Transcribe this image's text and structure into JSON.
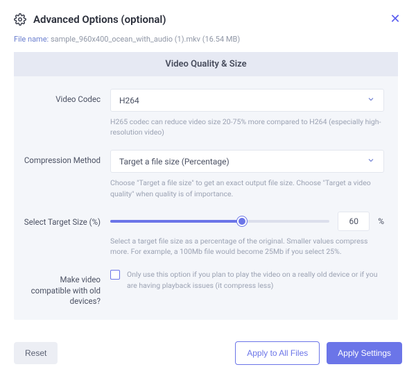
{
  "header": {
    "title": "Advanced Options (optional)"
  },
  "file": {
    "label": "File name:",
    "value": "sample_960x400_ocean_with_audio (1).mkv (16.54 MB)"
  },
  "panel": {
    "title": "Video Quality & Size",
    "codec": {
      "label": "Video Codec",
      "value": "H264",
      "help": "H265 codec can reduce video size 20-75% more compared to H264 (especially high-resolution video)"
    },
    "method": {
      "label": "Compression Method",
      "value": "Target a file size (Percentage)",
      "help": "Choose \"Target a file size\" to get an exact output file size. Choose \"Target a video quality\" when quality is of importance."
    },
    "target": {
      "label": "Select Target Size (%)",
      "value": "60",
      "symbol": "%",
      "help": "Select a target file size as a percentage of the original. Smaller values compress more. For example, a 100Mb file would become 25Mb if you select 25%."
    },
    "compat": {
      "label": "Make video compatible with old devices?",
      "help": "Only use this option if you plan to play the video on a really old device or if you are having playback issues (it compress less)"
    }
  },
  "footer": {
    "reset": "Reset",
    "apply_all": "Apply to All Files",
    "apply": "Apply Settings"
  },
  "colors": {
    "accent": "#6b75e8"
  }
}
